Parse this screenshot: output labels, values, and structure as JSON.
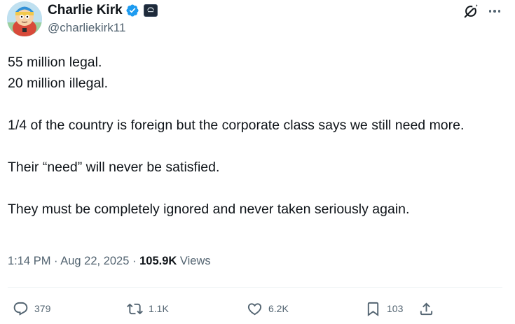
{
  "author": {
    "display_name": "Charlie Kirk",
    "handle": "@charliekirk11",
    "verified": true,
    "avatar": "cartoon-avatar"
  },
  "tweet": {
    "lines": [
      "55 million legal.",
      "20 million illegal.",
      "",
      "1/4 of the country is foreign but the corporate class says we still need more.",
      "",
      "Their “need” will never be satisfied.",
      "",
      "They must be completely ignored and never taken seriously again."
    ]
  },
  "meta": {
    "time": "1:14 PM",
    "separator": "·",
    "date": "Aug 22, 2025",
    "views_count": "105.9K",
    "views_label": "Views"
  },
  "actions": {
    "reply_count": "379",
    "repost_count": "1.1K",
    "like_count": "6.2K",
    "bookmark_count": "103"
  },
  "icons": {
    "verified": "verified-badge-icon",
    "grok": "grok-icon",
    "more": "more-options-icon",
    "reply": "reply-icon",
    "repost": "repost-icon",
    "like": "heart-icon",
    "bookmark": "bookmark-icon",
    "share": "share-icon"
  },
  "colors": {
    "verified_blue": "#1d9bf0",
    "text_primary": "#0f1419",
    "text_secondary": "#536471",
    "divider": "#eff3f4"
  }
}
